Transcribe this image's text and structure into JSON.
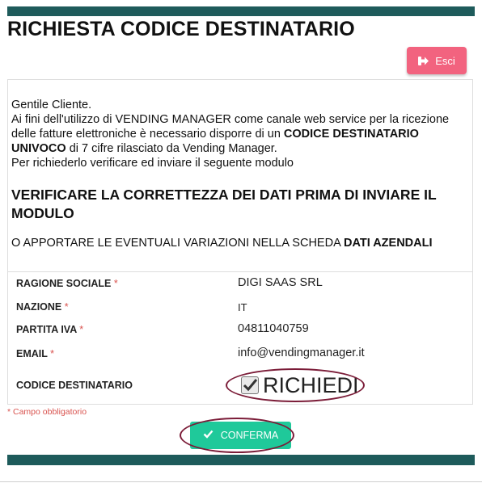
{
  "header": {
    "title": "RICHIESTA CODICE DESTINATARIO",
    "exit_label": "Esci"
  },
  "intro": {
    "greeting": "Gentile Cliente.",
    "line_part1": "Ai fini dell'utilizzo di VENDING MANAGER come canale web service per la ricezione delle fatture elettroniche è necessario disporre di un ",
    "line_bold": "CODICE DESTINATARIO UNIVOCO",
    "line_part2": " di 7 cifre rilasciato da Vending Manager.",
    "request_line": "Per richiederlo verificare ed inviare il seguente modulo"
  },
  "warning": {
    "title": "VERIFICARE LA CORRETTEZZA DEI DATI PRIMA DI INVIARE IL MODULO",
    "alt_text": "O APPORTARE LE EVENTUALI VARIAZIONI NELLA SCHEDA ",
    "alt_bold": "DATI AZENDALI"
  },
  "form": {
    "rows": [
      {
        "label": "RAGIONE SOCIALE",
        "value": "DIGI SAAS SRL"
      },
      {
        "label": "NAZIONE",
        "value": "IT"
      },
      {
        "label": "PARTITA IVA",
        "value": "04811040759"
      },
      {
        "label": "EMAIL",
        "value": "info@vendingmanager.it"
      }
    ],
    "required_mark": "*",
    "code_label": "CODICE DESTINATARIO",
    "code_option": "RICHIEDI",
    "code_checked": true,
    "required_note": "* Campo obbligatorio"
  },
  "actions": {
    "confirm_label": "CONFERMA"
  },
  "colors": {
    "bar": "#1e5b5b",
    "exit_button": "#f2637f",
    "confirm_button": "#1fc99a",
    "required": "#d9534f",
    "highlight": "#7b1c38"
  }
}
